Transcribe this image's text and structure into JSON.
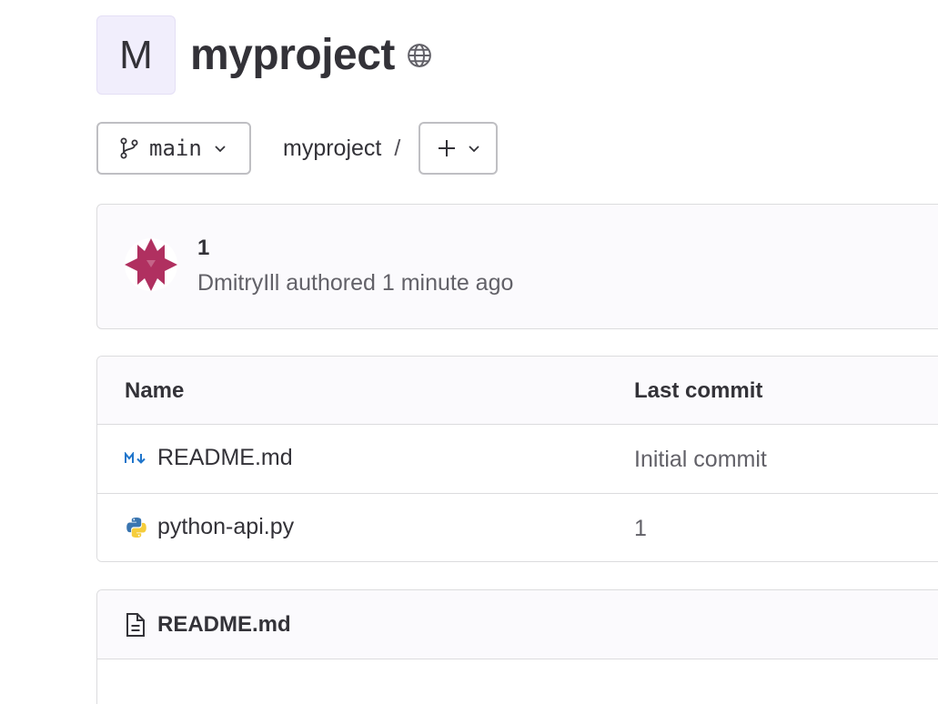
{
  "project": {
    "avatar_letter": "M",
    "name": "myproject",
    "visibility_icon": "globe-icon"
  },
  "toolbar": {
    "branch": "main",
    "branch_icon": "branch-icon",
    "breadcrumb": "myproject",
    "separator": "/",
    "add_icon": "plus-icon"
  },
  "last_commit": {
    "title": "1",
    "meta": "DmitryIll authored 1 minute ago",
    "avatar_color": "#b03060"
  },
  "files": {
    "headers": {
      "name": "Name",
      "last_commit": "Last commit"
    },
    "rows": [
      {
        "name": "README.md",
        "icon": "markdown-icon",
        "commit": "Initial commit"
      },
      {
        "name": "python-api.py",
        "icon": "python-icon",
        "commit": "1"
      }
    ]
  },
  "readme": {
    "title": "README.md",
    "icon": "document-icon"
  },
  "colors": {
    "text": "#333238",
    "muted": "#626168",
    "border": "#dcdcde",
    "avatar_bg": "#f1eefc"
  }
}
